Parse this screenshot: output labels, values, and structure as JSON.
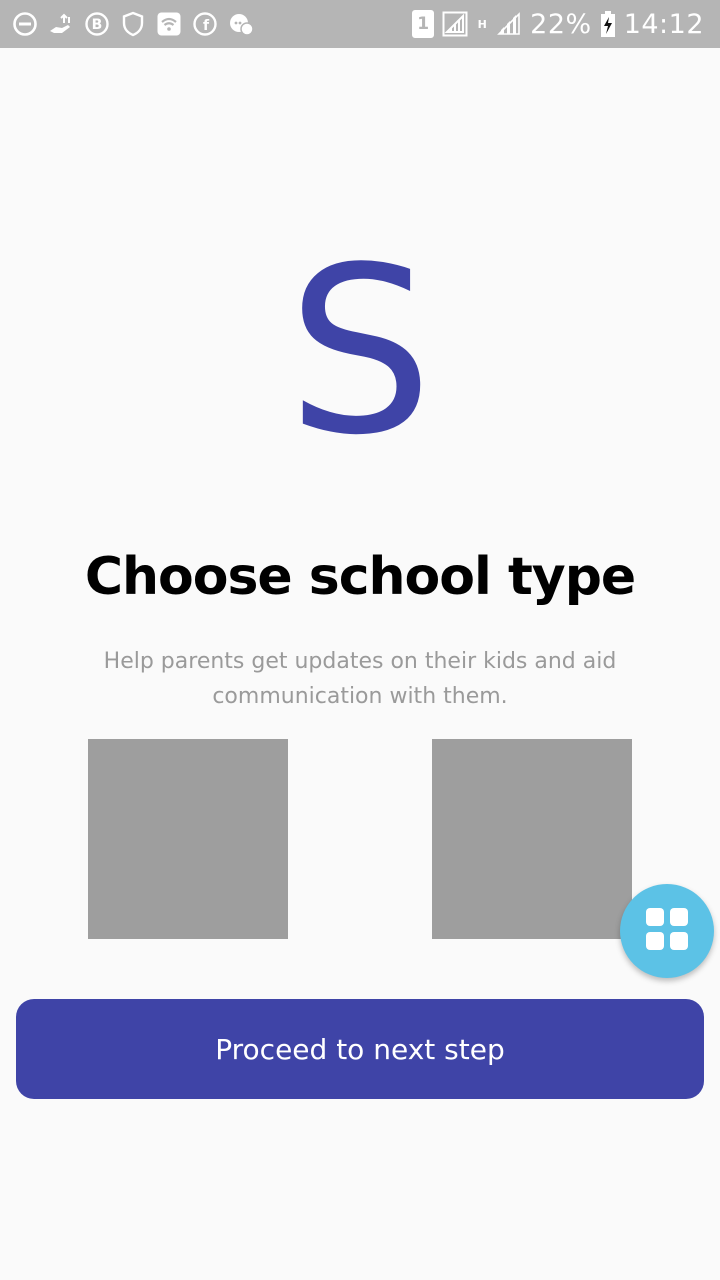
{
  "status_bar": {
    "battery": "22%",
    "time": "14:12",
    "sim_slot": "1",
    "network_type": "H",
    "left_icons": [
      "dnd-icon",
      "hand-upload-icon",
      "b-app-icon",
      "shield-icon",
      "wifi-icon",
      "facebook-icon",
      "chat-icon"
    ]
  },
  "logo": {
    "letter": "S"
  },
  "page": {
    "title": "Choose school type",
    "subtitle": "Help parents get updates on their kids and aid communication with them."
  },
  "options": [
    {
      "color": "#9e9e9e"
    },
    {
      "color": "#9e9e9e"
    }
  ],
  "fab": {
    "icon": "grid-icon",
    "color": "#5cc2e6"
  },
  "proceed_button": {
    "label": "Proceed to next step"
  },
  "colors": {
    "accent": "#3f44a7",
    "status_bar": "#b5b5b5",
    "background": "#fafafa"
  }
}
